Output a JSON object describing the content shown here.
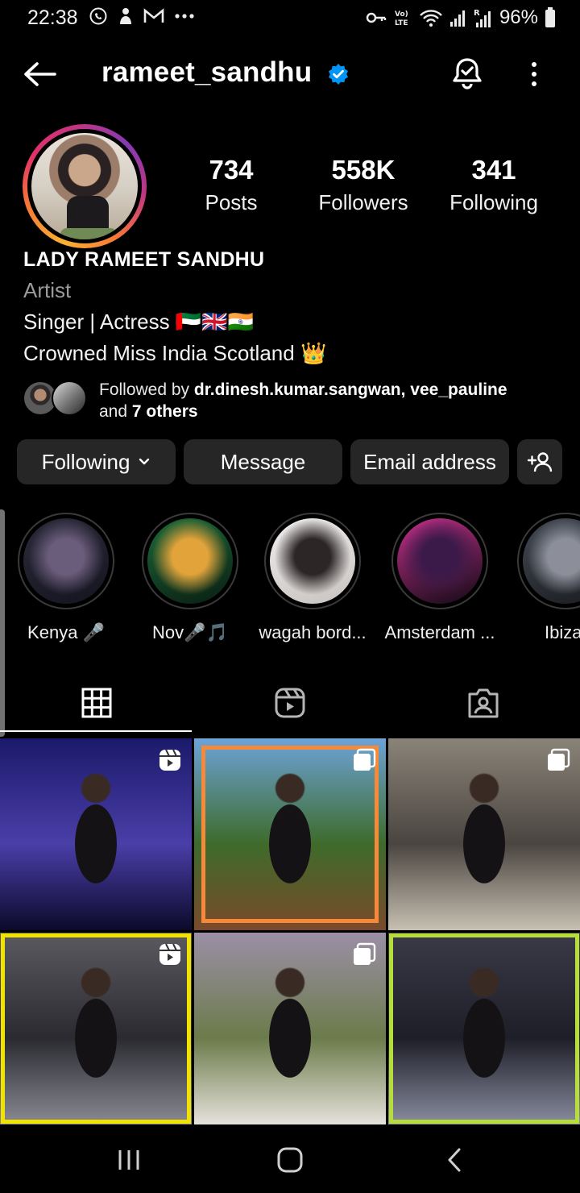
{
  "status_bar": {
    "time": "22:38",
    "battery": "96%",
    "left_icons": [
      "whatsapp-icon",
      "notification-icon",
      "gmail-icon",
      "more-dots-icon"
    ],
    "right_icons": [
      "key-icon",
      "volte-icon",
      "wifi-icon",
      "signal-icon",
      "signal-r-icon",
      "battery-icon"
    ]
  },
  "header": {
    "username": "rameet_sandhu",
    "verified": true
  },
  "profile": {
    "stats": [
      {
        "value": "734",
        "label": "Posts"
      },
      {
        "value": "558K",
        "label": "Followers"
      },
      {
        "value": "341",
        "label": "Following"
      }
    ],
    "name": "LADY RAMEET SANDHU",
    "category": "Artist",
    "bio_lines": [
      "Singer | Actress 🇦🇪🇬🇧🇮🇳",
      "Crowned Miss India Scotland 👑"
    ],
    "followed_by": {
      "prefix": "Followed by ",
      "names": "dr.dinesh.kumar.sangwan, vee_pauline",
      "and": "and ",
      "others": "7 others"
    }
  },
  "buttons": {
    "following": "Following",
    "message": "Message",
    "email": "Email address"
  },
  "highlights": [
    {
      "label": "Kenya 🎤",
      "colors": [
        "#2b2a3a",
        "#6a5c7b",
        "#151520"
      ]
    },
    {
      "label": "Nov🎤🎵",
      "colors": [
        "#1c6b3a",
        "#e2a33b",
        "#0a1d12"
      ]
    },
    {
      "label": "wagah bord...",
      "colors": [
        "#f0eeee",
        "#2c2626",
        "#c8c3c0"
      ]
    },
    {
      "label": "Amsterdam ...",
      "colors": [
        "#c2308a",
        "#3b1a4a",
        "#110a14"
      ]
    },
    {
      "label": "Ibiza",
      "colors": [
        "#444a55",
        "#8c8f99",
        "#1a1c20"
      ]
    }
  ],
  "tabs": [
    "grid-icon",
    "reels-icon",
    "tagged-icon"
  ],
  "posts": [
    {
      "type": "reel",
      "colors": [
        "#1b1a6a",
        "#4a3ea8",
        "#0c0a2a"
      ],
      "frame": ""
    },
    {
      "type": "multi",
      "colors": [
        "#6da3d8",
        "#3e6b2b",
        "#7a4a2a"
      ],
      "frame": "orange"
    },
    {
      "type": "multi",
      "colors": [
        "#8a8378",
        "#4a4540",
        "#c7c0b2"
      ],
      "frame": ""
    },
    {
      "type": "reel",
      "colors": [
        "#5a5a60",
        "#2a2a30",
        "#8a8a94"
      ],
      "frame": "yellow"
    },
    {
      "type": "multi",
      "colors": [
        "#9b8fa6",
        "#6b7b4a",
        "#e6e2dc"
      ],
      "frame": ""
    },
    {
      "type": "none",
      "colors": [
        "#3a3a48",
        "#1e1e28",
        "#8a8da0"
      ],
      "frame": "lime"
    }
  ]
}
